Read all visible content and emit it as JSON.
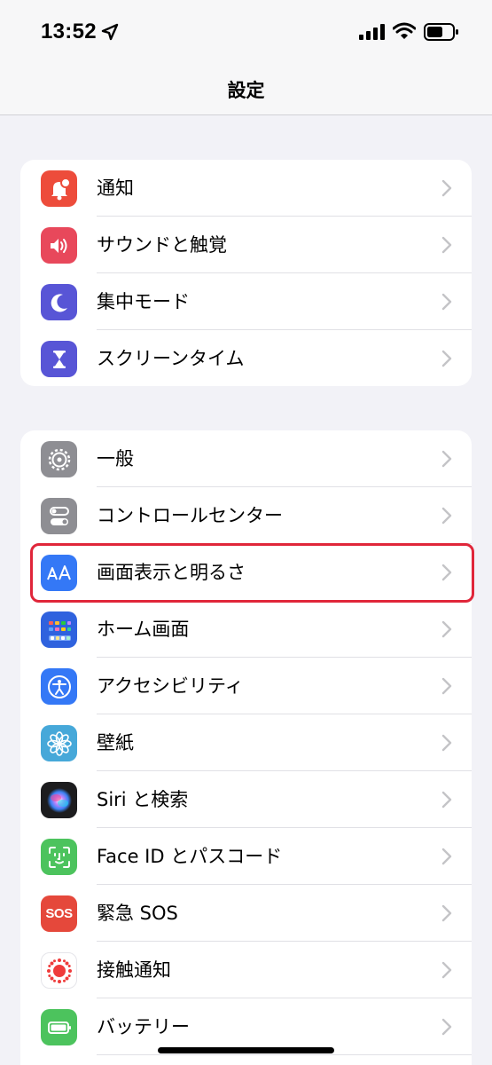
{
  "status_bar": {
    "time": "13:52"
  },
  "nav": {
    "title": "設定"
  },
  "group1": [
    {
      "label": "通知",
      "icon": "bell-badge-icon",
      "color": "#ed4c3b"
    },
    {
      "label": "サウンドと触覚",
      "icon": "speaker-wave-icon",
      "color": "#e8485b"
    },
    {
      "label": "集中モード",
      "icon": "moon-icon",
      "color": "#5855d6"
    },
    {
      "label": "スクリーンタイム",
      "icon": "hourglass-icon",
      "color": "#5855d6"
    }
  ],
  "group2": [
    {
      "label": "一般",
      "icon": "gear-icon",
      "color": "#8e8e93"
    },
    {
      "label": "コントロールセンター",
      "icon": "toggles-icon",
      "color": "#8e8e93"
    },
    {
      "label": "画面表示と明るさ",
      "icon": "text-size-icon",
      "color": "#3478f6"
    },
    {
      "label": "ホーム画面",
      "icon": "app-grid-icon",
      "color": "#2f62de"
    },
    {
      "label": "アクセシビリティ",
      "icon": "accessibility-icon",
      "color": "#3478f6"
    },
    {
      "label": "壁紙",
      "icon": "flower-icon",
      "color": "#46a8d9"
    },
    {
      "label": "Siri と検索",
      "icon": "siri-icon",
      "color": "#1c1c1e"
    },
    {
      "label": "Face ID とパスコード",
      "icon": "face-id-icon",
      "color": "#4cc35d"
    },
    {
      "label": "緊急 SOS",
      "icon": "sos-icon",
      "color": "#e5483b"
    },
    {
      "label": "接触通知",
      "icon": "exposure-icon",
      "color": "#ffffff"
    },
    {
      "label": "バッテリー",
      "icon": "battery-icon",
      "color": "#4cc35d"
    }
  ],
  "sos_text": "SOS"
}
